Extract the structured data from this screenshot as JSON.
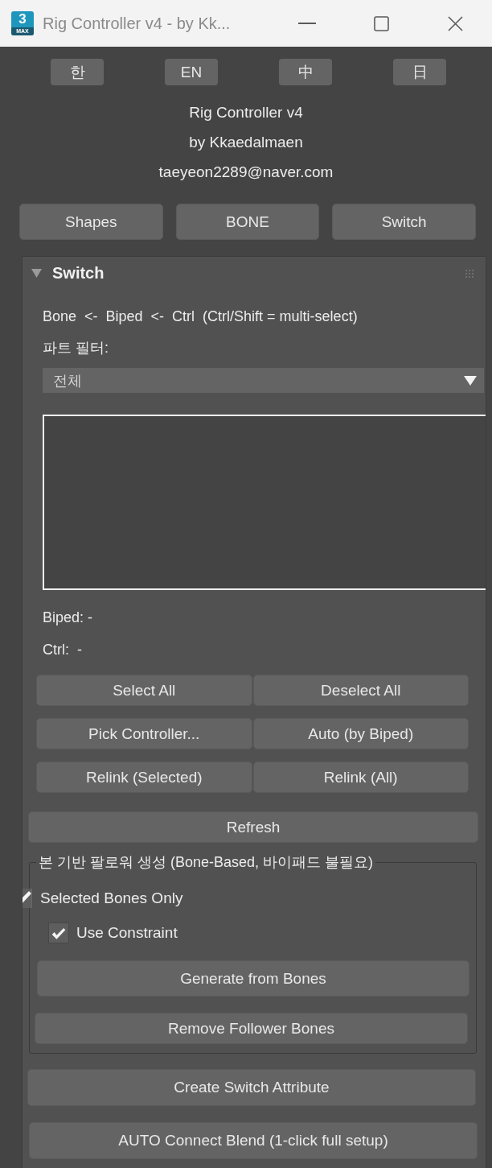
{
  "window": {
    "title": "Rig Controller v4 - by Kk...",
    "icon_number": "3",
    "icon_label": "MAX"
  },
  "language_buttons": [
    "한",
    "EN",
    "中",
    "日"
  ],
  "about": {
    "name": "Rig Controller v4",
    "author": "by Kkaedalmaen",
    "email": "taeyeon2289@naver.com"
  },
  "nav_buttons": [
    "Shapes",
    "BONE",
    "Switch"
  ],
  "rollout": {
    "title": "Switch",
    "expanded": true,
    "hint": "Bone  <-  Biped  <-  Ctrl  (Ctrl/Shift = multi-select)",
    "filter_label": "파트 필터:",
    "filter_dropdown": {
      "value": "전체"
    },
    "biped_status": "Biped: -",
    "ctrl_status": "Ctrl:  -",
    "action_buttons": [
      "Select All",
      "Deselect All",
      "Pick Controller...",
      "Auto (by Biped)",
      "Relink (Selected)",
      "Relink (All)"
    ],
    "refresh_button": "Refresh",
    "follower_group": {
      "title": "본 기반 팔로워 생성 (Bone-Based, 바이패드 불필요)",
      "selected_bones_only": {
        "label": "Selected Bones Only",
        "checked": true
      },
      "use_constraint": {
        "label": "Use Constraint",
        "checked": true
      },
      "buttons": [
        "Generate from Bones",
        "Remove Follower Bones"
      ]
    },
    "buttons": [
      "Create Switch Attribute",
      "AUTO Connect Blend (1-click full setup)"
    ]
  }
}
